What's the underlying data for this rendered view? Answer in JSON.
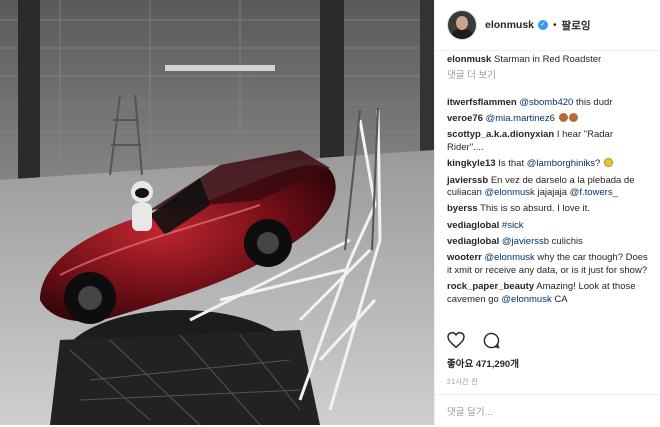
{
  "header": {
    "username": "elonmusk",
    "verified_badge": "✓",
    "separator": "•",
    "follow_label": "팔로잉"
  },
  "caption": {
    "username": "elonmusk",
    "text": "Starman in Red Roadster"
  },
  "more_comments_label": "댓글 더 보기",
  "comments": [
    {
      "user": "itwerfsflammen",
      "mention": "@sbomb420",
      "text": " this dudr"
    },
    {
      "user": "veroe76",
      "mention": "@mia.martinez6",
      "text": ""
    },
    {
      "user": "scottyp_a.k.a.dionyxian",
      "text": "I hear \"Radar Rider\"...."
    },
    {
      "user": "kingkyle13",
      "text": "Is that ",
      "mention": "@lamborghiniks",
      "tail": "?"
    },
    {
      "user": "javierssb",
      "text": "En vez de darselo a la plebada de culiacan ",
      "mention": "@elonmusk",
      "tail": " jajajaja ",
      "mention2": "@f.towers_"
    },
    {
      "user": "byerss",
      "text": "This is so absurd. I love it."
    },
    {
      "user": "vediaglobal",
      "mention": "#sick",
      "text": ""
    },
    {
      "user": "vediaglobal",
      "mention": "@javierssb",
      "text": " culichis"
    },
    {
      "user": "wooterr",
      "mention": "@elonmusk",
      "text": " why the car though? Does it xmit or receive any data, or is it just for show?"
    },
    {
      "user": "rock_paper_beauty",
      "text": "Amazing! Look at those cavemen go ",
      "mention": "@elonmusk",
      "tail": " CA"
    }
  ],
  "likes_text": "좋아요 471,290개",
  "timestamp": "21시간 전",
  "add_comment_placeholder": "댓글 달기..."
}
